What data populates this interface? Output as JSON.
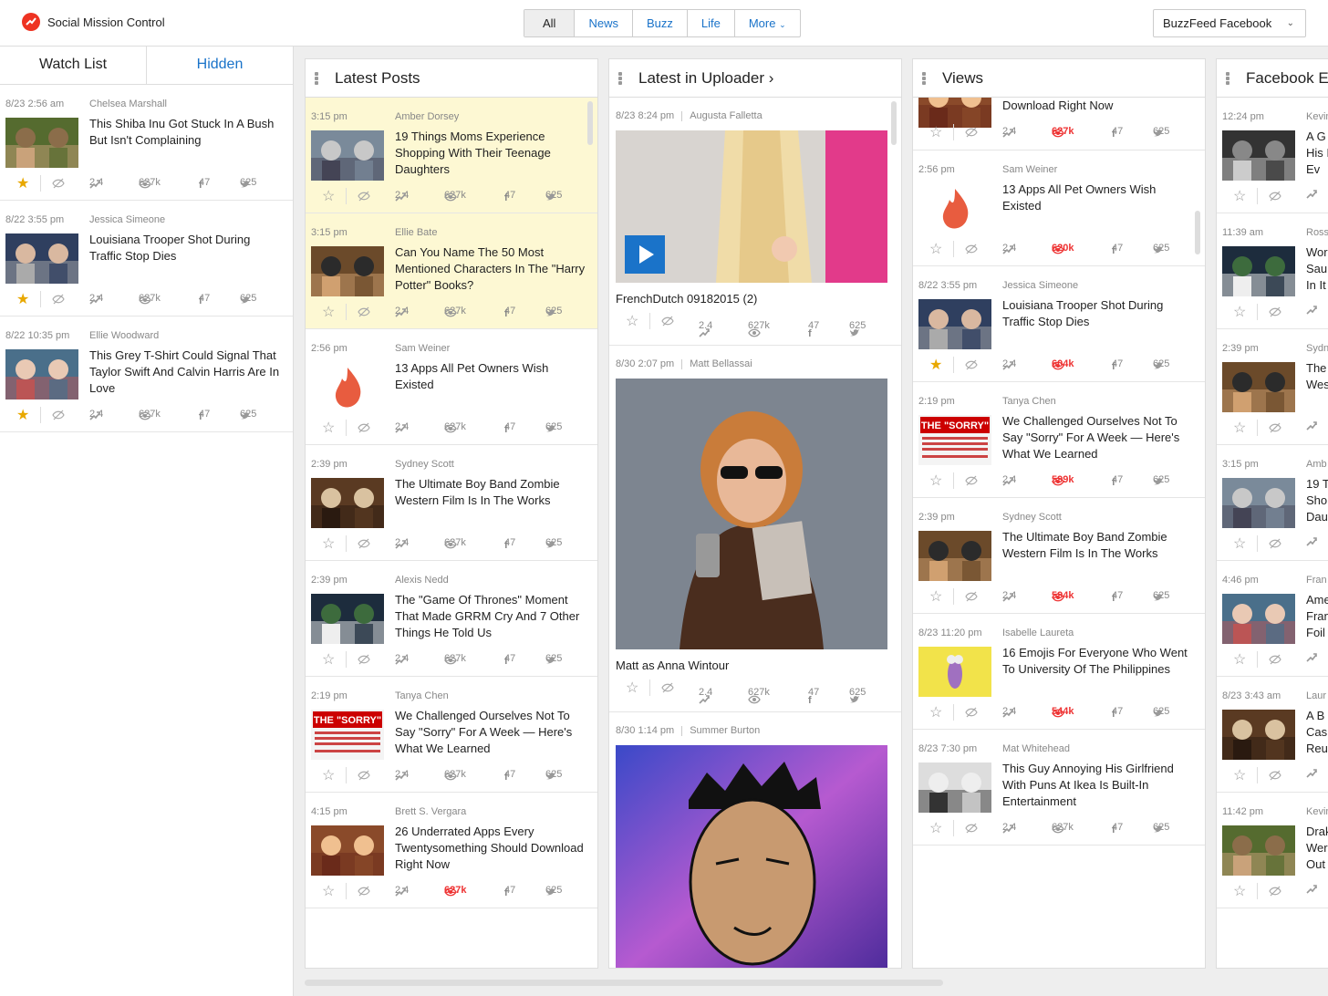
{
  "app": {
    "title": "Social Mission Control"
  },
  "filters": [
    "All",
    "News",
    "Buzz",
    "Life",
    "More"
  ],
  "account": "BuzzFeed Facebook",
  "sidebar": {
    "tabs": [
      "Watch List",
      "Hidden"
    ],
    "items": [
      {
        "time": "8/23 2:56 am",
        "author": "Chelsea Marshall",
        "title": "This Shiba Inu Got Stuck In A Bush But Isn't Complaining",
        "trend": "2.4",
        "views": "627k",
        "fb": "47",
        "tw": "625",
        "starred": true
      },
      {
        "time": "8/22 3:55 pm",
        "author": "Jessica Simeone",
        "title": "Louisiana Trooper Shot During Traffic Stop Dies",
        "trend": "2.4",
        "views": "627k",
        "fb": "47",
        "tw": "625",
        "starred": true
      },
      {
        "time": "8/22 10:35 pm",
        "author": "Ellie Woodward",
        "title": "This Grey T-Shirt Could Signal That Taylor Swift And Calvin Harris Are In Love",
        "trend": "2.4",
        "views": "627k",
        "fb": "47",
        "tw": "625",
        "starred": true
      }
    ]
  },
  "latest": {
    "title": "Latest Posts",
    "items": [
      {
        "time": "3:15 pm",
        "author": "Amber Dorsey",
        "title": "19 Things Moms Experience Shopping With Their Teenage Daughters",
        "trend": "2.4",
        "views": "627k",
        "fb": "47",
        "tw": "625"
      },
      {
        "time": "3:15 pm",
        "author": "Ellie Bate",
        "title": "Can You Name The 50 Most Mentioned Characters In The \"Harry Potter\" Books?",
        "trend": "2.4",
        "views": "627k",
        "fb": "47",
        "tw": "625"
      },
      {
        "time": "2:56 pm",
        "author": "Sam Weiner",
        "title": "13 Apps All Pet Owners Wish Existed",
        "trend": "2.4",
        "views": "627k",
        "fb": "47",
        "tw": "625"
      },
      {
        "time": "2:39 pm",
        "author": "Sydney Scott",
        "title": "The Ultimate Boy Band Zombie Western Film Is In The Works",
        "trend": "2.4",
        "views": "627k",
        "fb": "47",
        "tw": "625"
      },
      {
        "time": "2:39 pm",
        "author": "Alexis Nedd",
        "title": "The \"Game Of Thrones\" Moment That Made GRRM Cry And 7 Other Things He Told Us",
        "trend": "2.4",
        "views": "627k",
        "fb": "47",
        "tw": "625"
      },
      {
        "time": "2:19 pm",
        "author": "Tanya Chen",
        "title": "We Challenged Ourselves Not To Say \"Sorry\" For A Week — Here's What We Learned",
        "trend": "2.4",
        "views": "627k",
        "fb": "47",
        "tw": "625"
      },
      {
        "time": "4:15 pm",
        "author": "Brett S. Vergara",
        "title": "26 Underrated Apps Every Twentysomething Should Download Right Now",
        "trend": "2.4",
        "views": "627k",
        "fb": "47",
        "tw": "625"
      }
    ]
  },
  "uploader": {
    "title": "Latest in Uploader ›",
    "items": [
      {
        "time": "8/23 8:24 pm",
        "author": "Augusta Falletta",
        "caption": "FrenchDutch 09182015 (2)",
        "trend": "2.4",
        "views": "627k",
        "fb": "47",
        "tw": "625"
      },
      {
        "time": "8/30 2:07 pm",
        "author": "Matt Bellassai",
        "caption": "Matt as Anna Wintour",
        "trend": "2.4",
        "views": "627k",
        "fb": "47",
        "tw": "625"
      },
      {
        "time": "8/30 1:14 pm",
        "author": "Summer Burton"
      }
    ]
  },
  "views": {
    "title": "Views",
    "partial": {
      "title": "Download Right Now",
      "trend": "2.4",
      "views": "627k",
      "fb": "47",
      "tw": "625"
    },
    "items": [
      {
        "time": "2:56 pm",
        "author": "Sam Weiner",
        "title": "13 Apps All Pet Owners Wish Existed",
        "trend": "2.4",
        "views": "620k",
        "fb": "47",
        "tw": "625"
      },
      {
        "time": "8/22 3:55 pm",
        "author": "Jessica Simeone",
        "title": "Louisiana Trooper Shot During Traffic Stop Dies",
        "trend": "2.4",
        "views": "604k",
        "fb": "47",
        "tw": "625"
      },
      {
        "time": "2:19 pm",
        "author": "Tanya Chen",
        "title": "We Challenged Ourselves Not To Say \"Sorry\" For A Week — Here's What We Learned",
        "trend": "2.4",
        "views": "599k",
        "fb": "47",
        "tw": "625"
      },
      {
        "time": "2:39 pm",
        "author": "Sydney Scott",
        "title": "The Ultimate Boy Band Zombie Western Film Is In The Works",
        "trend": "2.4",
        "views": "594k",
        "fb": "47",
        "tw": "625"
      },
      {
        "time": "8/23 11:20 pm",
        "author": "Isabelle Laureta",
        "title": "16 Emojis For Everyone Who Went To University Of The Philippines",
        "trend": "2.4",
        "views": "544k",
        "fb": "47",
        "tw": "625"
      },
      {
        "time": "8/23 7:30 pm",
        "author": "Mat Whitehead",
        "title": "This Guy Annoying His Girlfriend With Puns At Ikea Is Built-In Entertainment",
        "trend": "2.4",
        "views": "627k",
        "fb": "47",
        "tw": "625"
      }
    ]
  },
  "facebook": {
    "title": "Facebook E",
    "items": [
      {
        "time": "12:24 pm",
        "author": "Kevin",
        "title": "A G His It Ev"
      },
      {
        "time": "11:39 am",
        "author": "Ross",
        "title": "Wor Sau In It"
      },
      {
        "time": "2:39 pm",
        "author": "Sydn",
        "title": "The Wes"
      },
      {
        "time": "3:15 pm",
        "author": "Amb",
        "title": "19 T Sho Dau"
      },
      {
        "time": "4:46 pm",
        "author": "Fran",
        "title": "Ame Fran Foil"
      },
      {
        "time": "8/23 3:43 am",
        "author": "Laur",
        "title": "A B Cas Reu"
      },
      {
        "time": "11:42 pm",
        "author": "Kevin",
        "title": "Drak Were Out"
      }
    ]
  },
  "colors": {
    "accent": "#1a73c9",
    "red": "#e33",
    "star": "#e8a800",
    "highlight": "#fdf8d3"
  }
}
